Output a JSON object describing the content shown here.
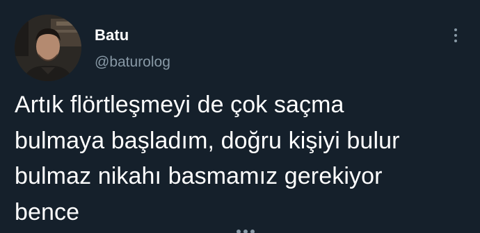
{
  "tweet": {
    "author": {
      "display_name": "Batu",
      "handle": "@baturolog",
      "avatar_icon": "profile-photo"
    },
    "text": "Artık flörtleşmeyi de çok saçma\nbulmaya başladım, doğru kişiyi bulur\nbulmaz nikahı basmamız gerekiyor\nbence",
    "more_icon": "more-options-icon"
  },
  "colors": {
    "background": "#15202b",
    "primary_text": "#ffffff",
    "secondary_text": "#8899a6"
  }
}
